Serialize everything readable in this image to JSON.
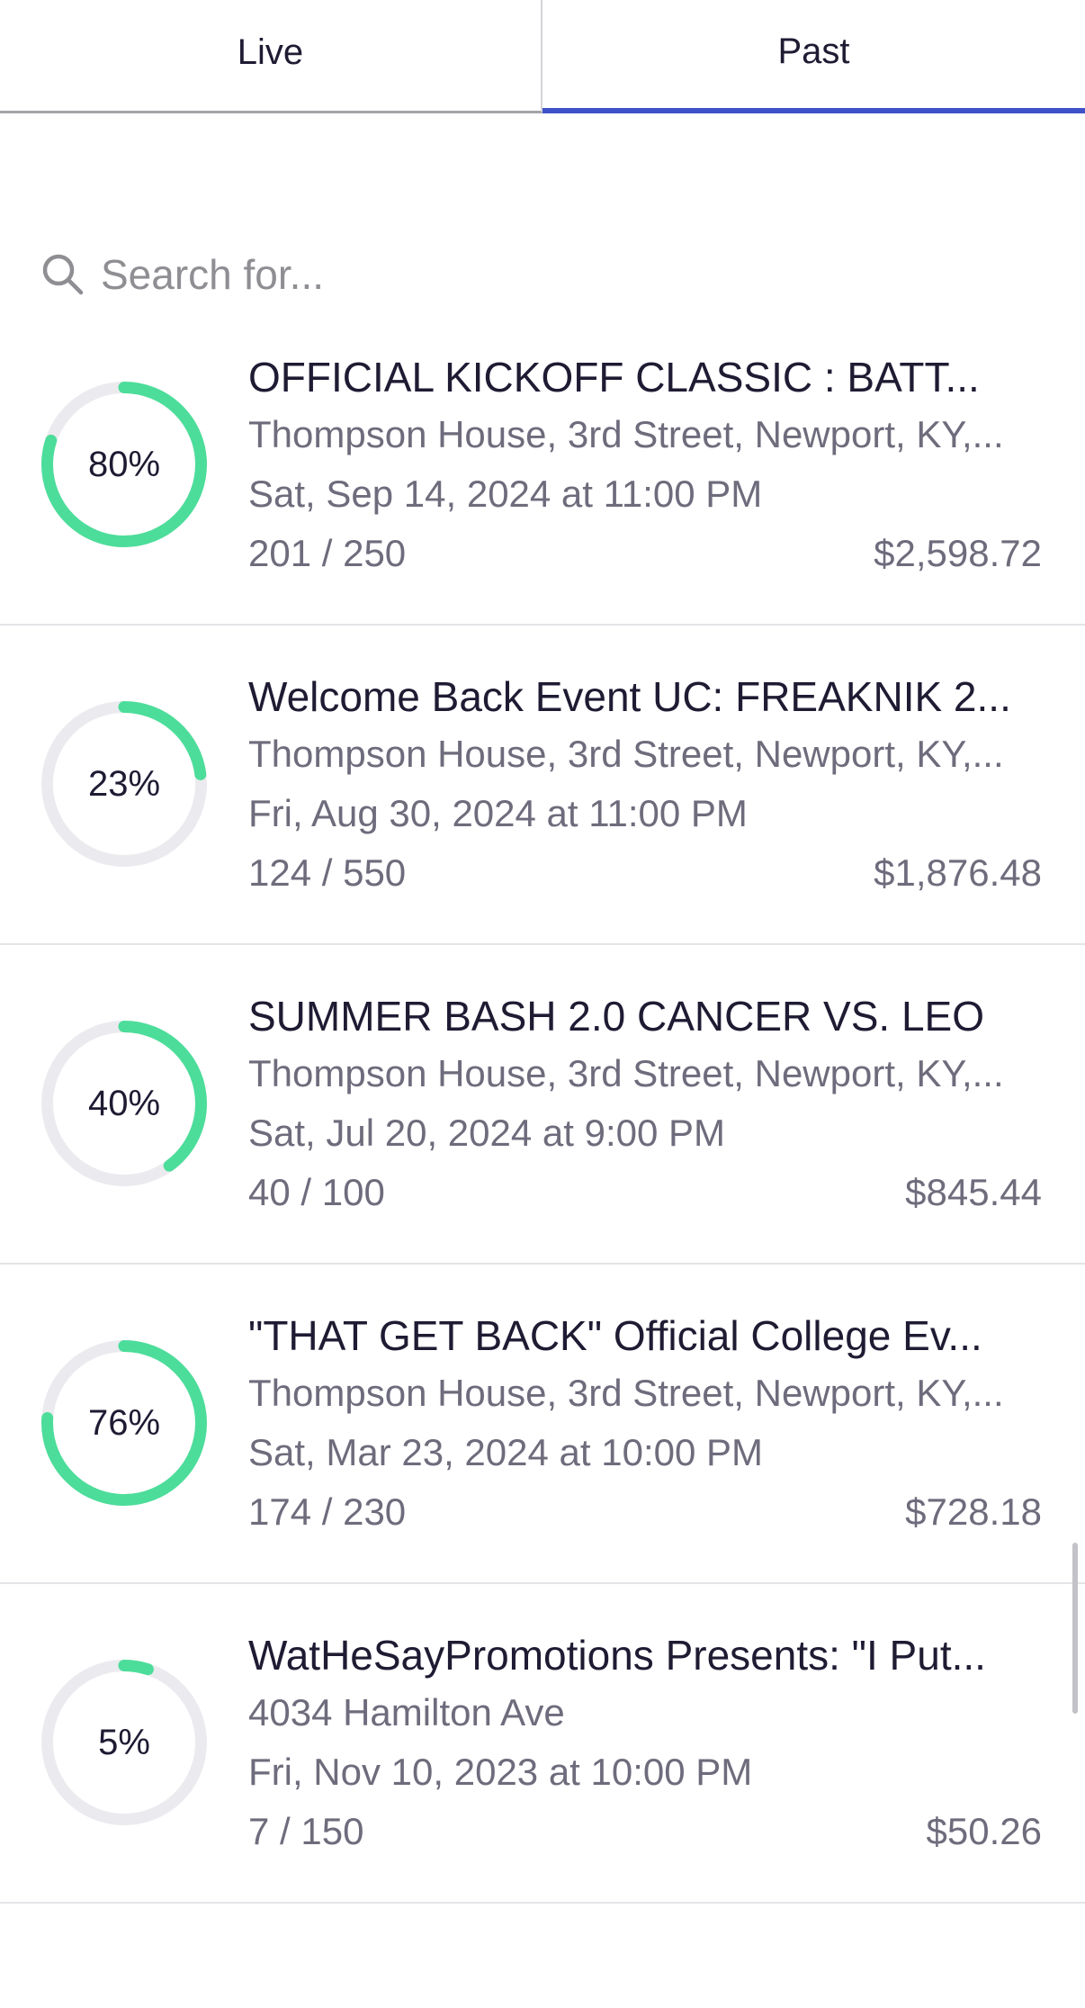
{
  "tabs": [
    {
      "label": "Live",
      "active": false
    },
    {
      "label": "Past",
      "active": true
    }
  ],
  "search": {
    "placeholder": "Search for..."
  },
  "colors": {
    "accent": "#3f51c8",
    "progress": "#4cdd9a",
    "ring_track": "#ebebef"
  },
  "events": [
    {
      "percent_label": "80%",
      "progress": 0.8,
      "title": "OFFICIAL KICKOFF  CLASSIC : BATT...",
      "location": "Thompson House, 3rd Street, Newport, KY,...",
      "datetime": "Sat, Sep 14, 2024 at 11:00 PM",
      "tickets": "201 / 250",
      "revenue": "$2,598.72"
    },
    {
      "percent_label": "23%",
      "progress": 0.23,
      "title": "Welcome Back Event UC: FREAKNIK 2...",
      "location": "Thompson House, 3rd Street, Newport, KY,...",
      "datetime": "Fri, Aug 30, 2024 at 11:00 PM",
      "tickets": "124 / 550",
      "revenue": "$1,876.48"
    },
    {
      "percent_label": "40%",
      "progress": 0.4,
      "title": "SUMMER BASH 2.0 CANCER VS. LEO",
      "location": "Thompson House, 3rd Street, Newport, KY,...",
      "datetime": "Sat, Jul 20, 2024 at 9:00 PM",
      "tickets": "40 / 100",
      "revenue": "$845.44"
    },
    {
      "percent_label": "76%",
      "progress": 0.76,
      "title": "\"THAT GET BACK\" Official College Ev...",
      "location": "Thompson House, 3rd Street, Newport, KY,...",
      "datetime": "Sat, Mar 23, 2024 at 10:00 PM",
      "tickets": "174 / 230",
      "revenue": "$728.18"
    },
    {
      "percent_label": "5%",
      "progress": 0.05,
      "title": "WatHeSayPromotions Presents:  \"I Put...",
      "location": "4034 Hamilton Ave",
      "datetime": "Fri, Nov 10, 2023 at 10:00 PM",
      "tickets": "7 / 150",
      "revenue": "$50.26"
    }
  ]
}
